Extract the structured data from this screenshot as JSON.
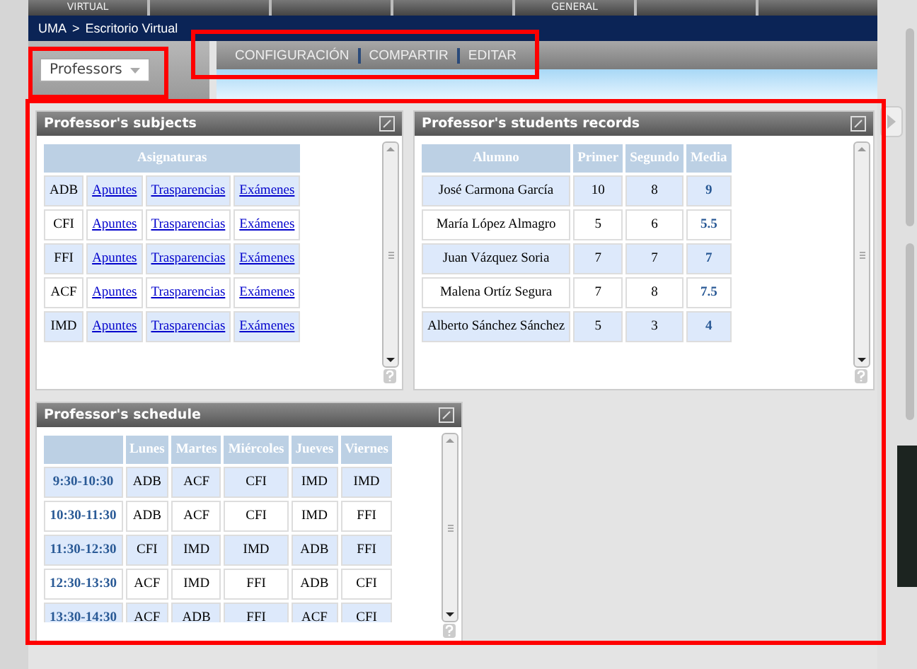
{
  "top_tabs": {
    "labels": [
      "VIRTUAL",
      "GENERAL"
    ]
  },
  "breadcrumb": {
    "items": [
      "UMA",
      "Escritorio Virtual"
    ],
    "separator": ">"
  },
  "role_select": {
    "value": "Professors"
  },
  "toolbar": {
    "items": [
      "CONFIGURACIÓN",
      "COMPARTIR",
      "EDITAR"
    ]
  },
  "panels": [
    {
      "title": "Professor's subjects",
      "kind": "subjects",
      "columns": [
        {
          "label": "Asignaturas",
          "colspan": 4
        }
      ],
      "rows": [
        [
          "ADB",
          "Apuntes",
          "Trasparencias",
          "Exámenes"
        ],
        [
          "CFI",
          "Apuntes",
          "Trasparencias",
          "Exámenes"
        ],
        [
          "FFI",
          "Apuntes",
          "Trasparencias",
          "Exámenes"
        ],
        [
          "ACF",
          "Apuntes",
          "Trasparencias",
          "Exámenes"
        ],
        [
          "IMD",
          "Apuntes",
          "Trasparencias",
          "Exámenes"
        ]
      ]
    },
    {
      "title": "Professor's students records",
      "kind": "grades",
      "columns": [
        {
          "label": "Alumno"
        },
        {
          "label": "Primer"
        },
        {
          "label": "Segundo"
        },
        {
          "label": "Media"
        }
      ],
      "rows": [
        [
          "José Carmona García",
          "10",
          "8",
          "9"
        ],
        [
          "María López Almagro",
          "5",
          "6",
          "5.5"
        ],
        [
          "Juan Vázquez Soria",
          "7",
          "7",
          "7"
        ],
        [
          "Malena Ortíz Segura",
          "7",
          "8",
          "7.5"
        ],
        [
          "Alberto Sánchez Sánchez",
          "5",
          "3",
          "4"
        ]
      ]
    },
    {
      "title": "Professor's schedule",
      "kind": "schedule",
      "columns": [
        null,
        {
          "label": "Lunes"
        },
        {
          "label": "Martes"
        },
        {
          "label": "Miércoles"
        },
        {
          "label": "Jueves"
        },
        {
          "label": "Viernes"
        }
      ],
      "rows": [
        [
          "9:30-10:30",
          "ADB",
          "ACF",
          "CFI",
          "IMD",
          "IMD"
        ],
        [
          "10:30-11:30",
          "ADB",
          "ACF",
          "CFI",
          "IMD",
          "FFI"
        ],
        [
          "11:30-12:30",
          "CFI",
          "IMD",
          "IMD",
          "ADB",
          "FFI"
        ],
        [
          "12:30-13:30",
          "ACF",
          "IMD",
          "FFI",
          "ADB",
          "CFI"
        ],
        [
          "13:30-14:30",
          "ACF",
          "ADB",
          "FFI",
          "ACF",
          "CFI"
        ]
      ]
    }
  ]
}
